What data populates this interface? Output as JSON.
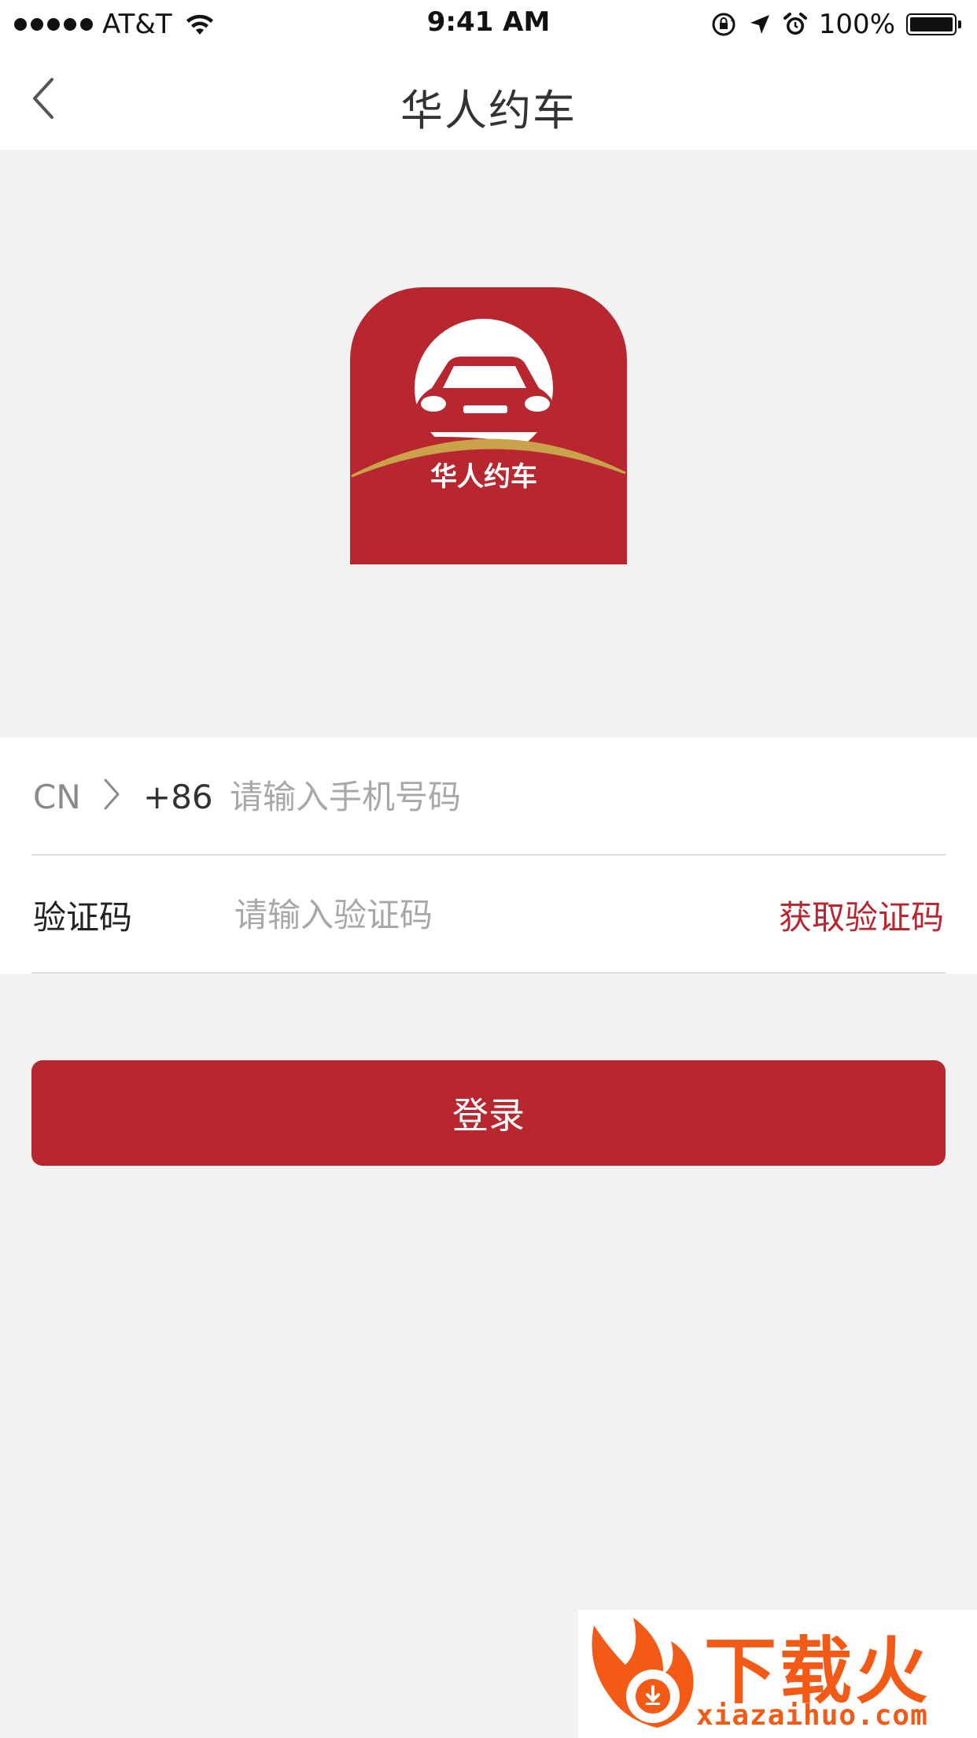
{
  "status_bar": {
    "carrier": "AT&T",
    "time": "9:41 AM",
    "battery": "100%",
    "icons": [
      "signal-icon",
      "wifi-icon",
      "orientation-lock-icon",
      "location-icon",
      "alarm-icon",
      "battery-icon"
    ]
  },
  "nav": {
    "title": "华人约车",
    "back_icon": "chevron-left-icon"
  },
  "logo": {
    "text": "华人约车",
    "colors": {
      "background": "#b8262f",
      "circle": "#ffffff",
      "arc": "#c9a24a"
    }
  },
  "form": {
    "phone": {
      "country": "CN",
      "dial_code": "+86",
      "placeholder": "请输入手机号码",
      "value": ""
    },
    "code": {
      "label": "验证码",
      "placeholder": "请输入验证码",
      "value": "",
      "action": "获取验证码"
    }
  },
  "login_button": "登录",
  "watermark": {
    "title": "下载火",
    "url": "xiazaihuo.com"
  },
  "colors": {
    "accent": "#b8262f",
    "page_background": "#f2f2f2",
    "watermark": "#f25a16"
  }
}
